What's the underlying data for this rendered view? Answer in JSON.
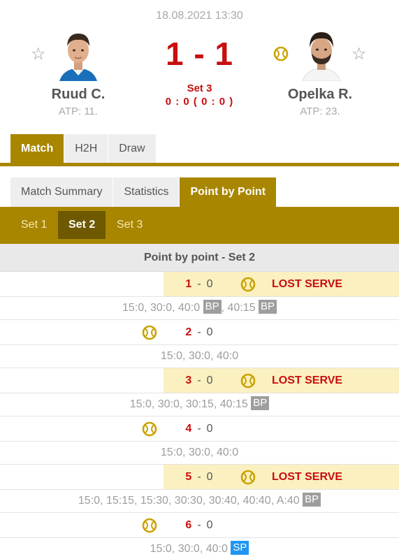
{
  "match": {
    "datetime": "18.08.2021 13:30",
    "score": "1 - 1",
    "set_label": "Set 3",
    "set_score": "0 : 0 ( 0 : 0 )",
    "player1": {
      "name": "Ruud C.",
      "rank": "ATP: 11."
    },
    "player2": {
      "name": "Opelka R.",
      "rank": "ATP: 23."
    }
  },
  "main_tabs": [
    "Match",
    "H2H",
    "Draw"
  ],
  "sub_tabs": [
    "Match Summary",
    "Statistics",
    "Point by Point"
  ],
  "set_tabs": [
    "Set 1",
    "Set 2",
    "Set 3"
  ],
  "pbp_title": "Point by point - Set 2",
  "dash": "-",
  "lost_serve_label": "LOST SERVE",
  "games": [
    {
      "home": "1",
      "away": "0",
      "server": "away",
      "lost_serve": true,
      "points": [
        {
          "t": "15:0, 30:0, 40:0 "
        },
        {
          "b": "BP"
        },
        {
          "t": ", 40:15 "
        },
        {
          "b": "BP"
        }
      ]
    },
    {
      "home": "2",
      "away": "0",
      "server": "home",
      "lost_serve": false,
      "points": [
        {
          "t": "15:0, 30:0, 40:0"
        }
      ]
    },
    {
      "home": "3",
      "away": "0",
      "server": "away",
      "lost_serve": true,
      "points": [
        {
          "t": "15:0, 30:0, 30:15, 40:15 "
        },
        {
          "b": "BP"
        }
      ]
    },
    {
      "home": "4",
      "away": "0",
      "server": "home",
      "lost_serve": false,
      "points": [
        {
          "t": "15:0, 30:0, 40:0"
        }
      ]
    },
    {
      "home": "5",
      "away": "0",
      "server": "away",
      "lost_serve": true,
      "points": [
        {
          "t": "15:0, 15:15, 15:30, 30:30, 30:40, 40:40, A:40 "
        },
        {
          "b": "BP"
        }
      ]
    },
    {
      "home": "6",
      "away": "0",
      "server": "home",
      "lost_serve": false,
      "points": [
        {
          "t": "15:0, 30:0, 40:0 "
        },
        {
          "b": "SP",
          "kind": "sp"
        }
      ]
    }
  ],
  "colors": {
    "accent_gold": "#a88600",
    "score_red": "#c80e0e",
    "lost_serve_bg": "#fbf0c0",
    "badge_grey": "#9e9e9e",
    "badge_blue": "#1f96f2"
  },
  "icons": {
    "favorite": "star-outline-icon",
    "serve": "tennis-ball-icon",
    "player_photo": "player-photo"
  }
}
